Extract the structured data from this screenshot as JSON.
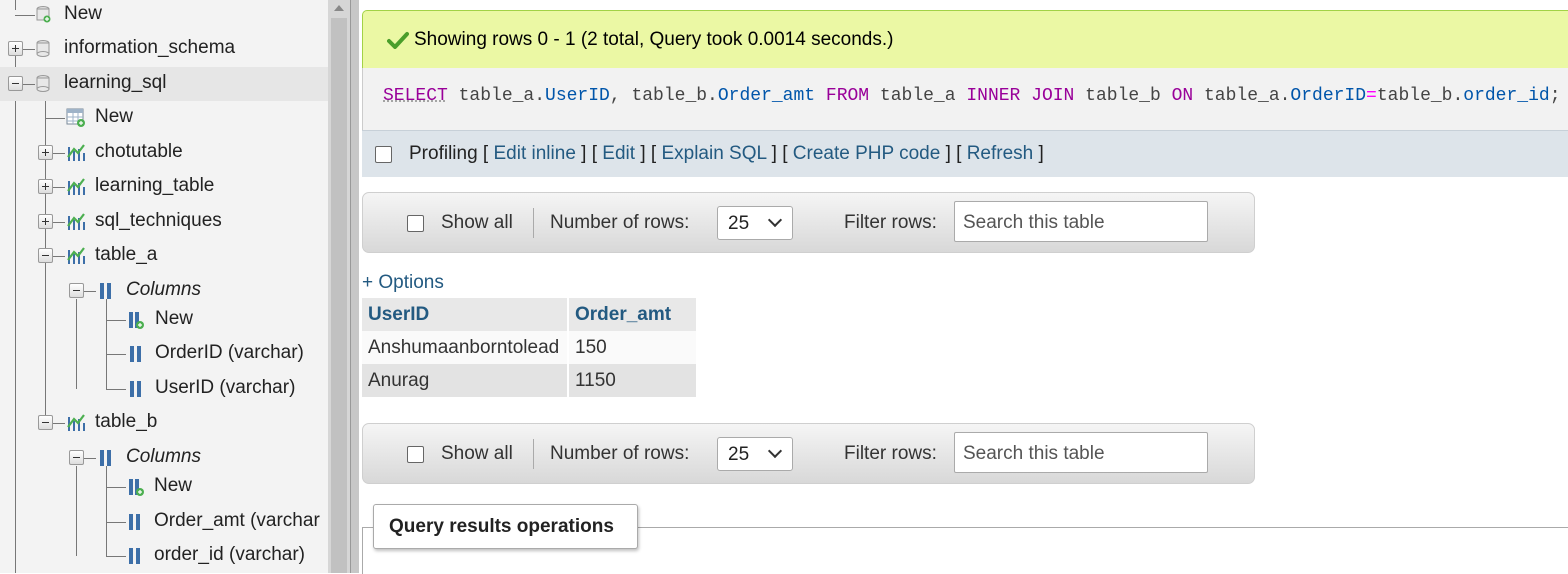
{
  "nav": {
    "new_top": "New",
    "information_schema": "information_schema",
    "learning_sql": "learning_sql",
    "learning_sql_new": "New",
    "chotutable": "chotutable",
    "learning_table": "learning_table",
    "sql_techniques": "sql_techniques",
    "table_a": {
      "name": "table_a",
      "columns_label": "Columns",
      "new_label": "New",
      "columns": [
        "OrderID (varchar)",
        "UserID (varchar)"
      ]
    },
    "table_b": {
      "name": "table_b",
      "columns_label": "Columns",
      "new_label": "New",
      "columns": [
        "Order_amt (varchar",
        "order_id (varchar)"
      ]
    }
  },
  "success": {
    "message": "Showing rows 0 - 1 (2 total, Query took 0.0014 seconds.)"
  },
  "sql": {
    "tokens": [
      {
        "t": "SELECT",
        "c": "kw"
      },
      {
        "t": " table_a.",
        "c": ""
      },
      {
        "t": "UserID",
        "c": "fld"
      },
      {
        "t": ", table_b.",
        "c": ""
      },
      {
        "t": "Order_amt",
        "c": "fld"
      },
      {
        "t": " ",
        "c": ""
      },
      {
        "t": "FROM",
        "c": "kw"
      },
      {
        "t": " table_a ",
        "c": ""
      },
      {
        "t": "INNER JOIN",
        "c": "kw"
      },
      {
        "t": " table_b ",
        "c": ""
      },
      {
        "t": "ON",
        "c": "kw"
      },
      {
        "t": " table_a.",
        "c": ""
      },
      {
        "t": "OrderID",
        "c": "fld"
      },
      {
        "t": "=",
        "c": "op"
      },
      {
        "t": "table_b.",
        "c": ""
      },
      {
        "t": "order_id",
        "c": "fld"
      },
      {
        "t": ";",
        "c": ""
      }
    ]
  },
  "profiling": {
    "label": "Profiling",
    "edit_inline": "Edit inline",
    "edit": "Edit",
    "explain": "Explain SQL",
    "php": "Create PHP code",
    "refresh": "Refresh"
  },
  "nav_bar": {
    "show_all": "Show all",
    "number_of_rows_label": "Number of rows:",
    "rows_value": "25",
    "filter_label": "Filter rows:",
    "search_placeholder": "Search this table"
  },
  "options_link": "+ Options",
  "results": {
    "headers": [
      "UserID",
      "Order_amt"
    ],
    "rows": [
      [
        "Anshumaanborntolead",
        "150"
      ],
      [
        "Anurag",
        "1150"
      ]
    ]
  },
  "query_results_operations": "Query results operations",
  "colors": {
    "success_bg": "#ebf8a4",
    "link": "#235a81",
    "keyword": "#990099",
    "field": "#0055aa"
  }
}
